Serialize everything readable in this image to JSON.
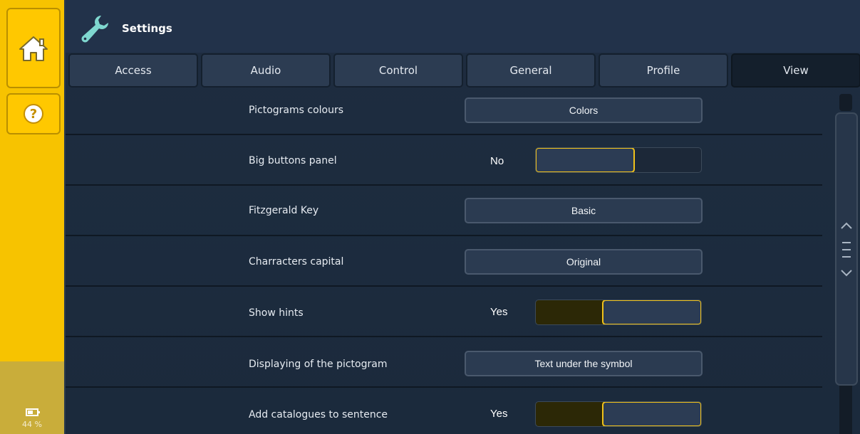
{
  "header": {
    "title": "Settings",
    "icon": "wrench-icon"
  },
  "sidebar": {
    "home_icon": "home-icon",
    "help_icon": "question-icon",
    "help_symbol": "?",
    "battery": {
      "icon": "battery-icon",
      "level": "44 %"
    }
  },
  "tabs": [
    {
      "label": "Access",
      "active": false
    },
    {
      "label": "Audio",
      "active": false
    },
    {
      "label": "Control",
      "active": false
    },
    {
      "label": "General",
      "active": false
    },
    {
      "label": "Profile",
      "active": false
    },
    {
      "label": "View",
      "active": true
    }
  ],
  "rows": [
    {
      "label": "Pictograms colours",
      "type": "button",
      "value": "Colors"
    },
    {
      "label": "Big buttons panel",
      "type": "toggle",
      "value": "No"
    },
    {
      "label": "Fitzgerald Key",
      "type": "button",
      "value": "Basic"
    },
    {
      "label": "Charracters capital",
      "type": "button",
      "value": "Original"
    },
    {
      "label": "Show hints",
      "type": "toggle",
      "value": "Yes"
    },
    {
      "label": "Displaying of the pictogram",
      "type": "button",
      "value": "Text under the symbol"
    },
    {
      "label": "Add catalogues to sentence",
      "type": "toggle",
      "value": "Yes"
    }
  ],
  "colors": {
    "accent": "#f7c300",
    "toggle_border": "#f1c21a",
    "background": "#1d2b3d"
  }
}
